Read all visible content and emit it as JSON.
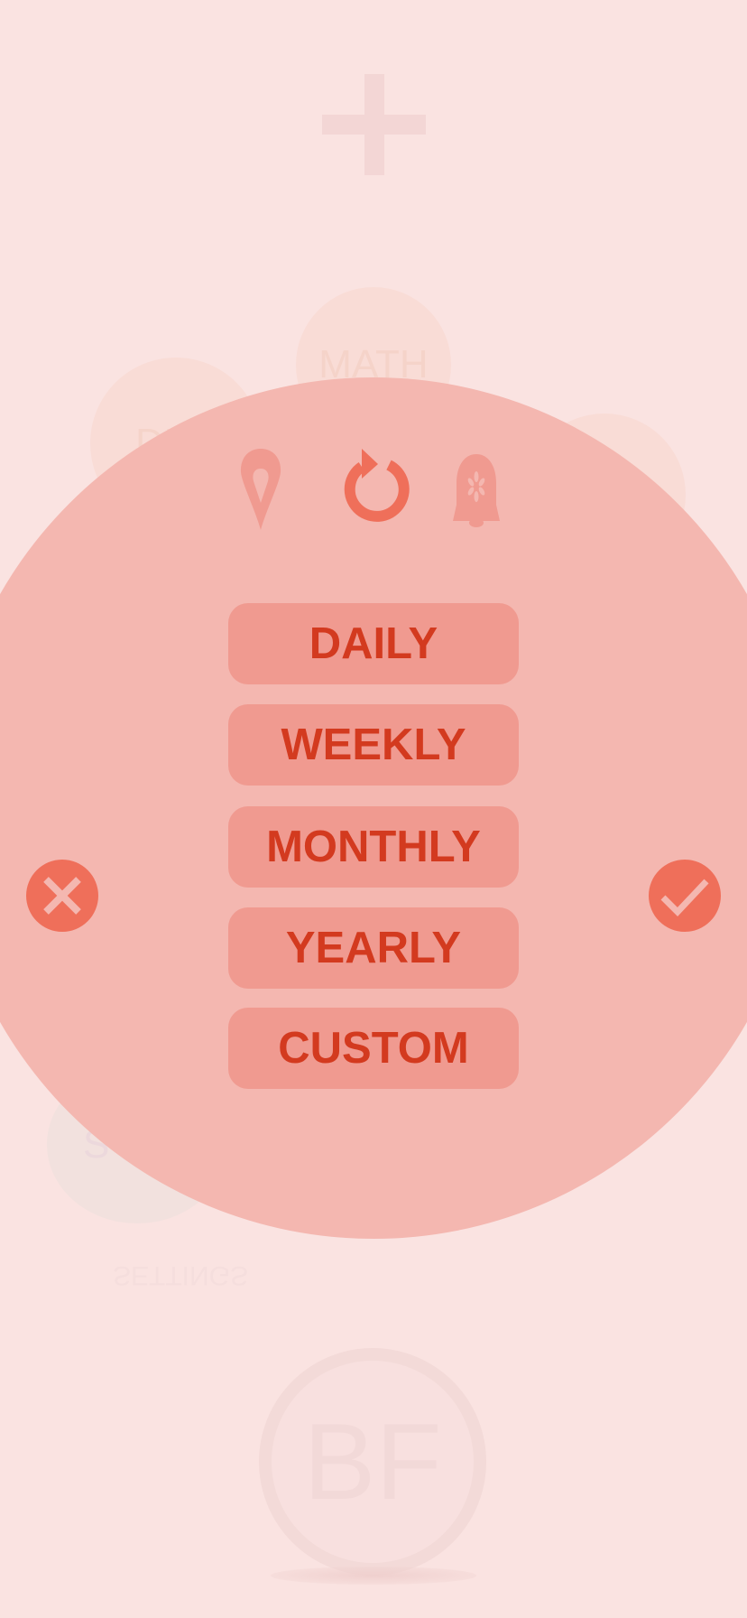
{
  "background": {
    "add_icon": "plus-icon",
    "bubbles": [
      "MATH",
      "DE",
      "S",
      "SETTINGS"
    ],
    "profile_initials": "BF"
  },
  "repeat_panel": {
    "icons": [
      "location-pin-icon",
      "repeat-icon",
      "bell-icon"
    ],
    "options": [
      "DAILY",
      "WEEKLY",
      "MONTHLY",
      "YEARLY",
      "CUSTOM"
    ],
    "cancel_icon": "close-icon",
    "confirm_icon": "check-icon"
  },
  "colors": {
    "background": "#fae3e1",
    "panel": "#f4b7b0",
    "button": "#f09a90",
    "button_text": "#d33a1f",
    "accent": "#ef6f5a"
  }
}
